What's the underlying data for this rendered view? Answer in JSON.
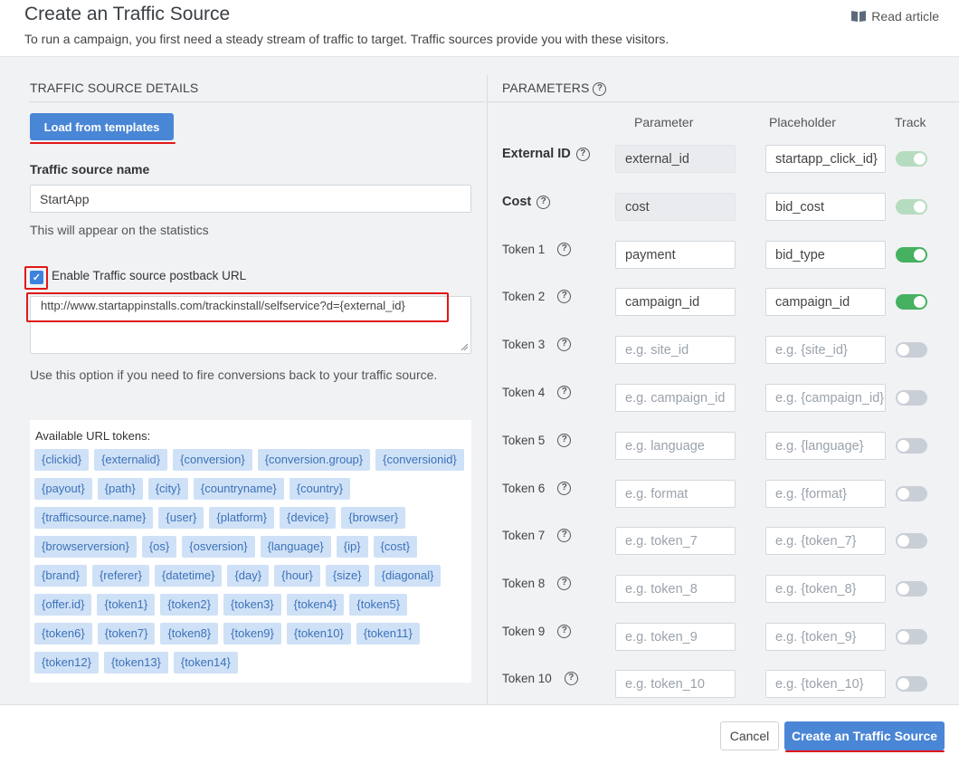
{
  "header": {
    "title": "Create an Traffic Source",
    "subtitle": "To run a campaign, you first need a steady stream of traffic to target. Traffic sources provide you with these visitors.",
    "read_article": "Read article"
  },
  "details": {
    "section_title": "TRAFFIC SOURCE DETAILS",
    "load_templates": "Load from templates",
    "name_label": "Traffic source name",
    "name_value": "StartApp",
    "name_help": "This will appear on the statistics",
    "postback_enabled": true,
    "postback_label": "Enable Traffic source postback URL",
    "postback_url": "http://www.startappinstalls.com/trackinstall/selfservice?d={external_id}",
    "postback_help": "Use this option if you need to fire conversions back to your traffic source.",
    "tokens_title": "Available URL tokens:",
    "tokens": [
      "{clickid}",
      "{externalid}",
      "{conversion}",
      "{conversion.group}",
      "{conversionid}",
      "{payout}",
      "{path}",
      "{city}",
      "{countryname}",
      "{country}",
      "{trafficsource.name}",
      "{user}",
      "{platform}",
      "{device}",
      "{browser}",
      "{browserversion}",
      "{os}",
      "{osversion}",
      "{language}",
      "{ip}",
      "{cost}",
      "{brand}",
      "{referer}",
      "{datetime}",
      "{day}",
      "{hour}",
      "{size}",
      "{diagonal}",
      "{offer.id}",
      "{token1}",
      "{token2}",
      "{token3}",
      "{token4}",
      "{token5}",
      "{token6}",
      "{token7}",
      "{token8}",
      "{token9}",
      "{token10}",
      "{token11}",
      "{token12}",
      "{token13}",
      "{token14}"
    ]
  },
  "parameters": {
    "section_title": "PARAMETERS",
    "col_parameter": "Parameter",
    "col_placeholder": "Placeholder",
    "col_track": "Track",
    "rows": [
      {
        "name": "External ID",
        "bold": true,
        "param": "external_id",
        "param_readonly": true,
        "placeholder": "startapp_click_id}",
        "placeholder_is_hint": false,
        "track": "dim"
      },
      {
        "name": "Cost",
        "bold": true,
        "param": "cost",
        "param_readonly": true,
        "placeholder": "bid_cost",
        "placeholder_is_hint": false,
        "track": "dim"
      },
      {
        "name": "Token 1",
        "bold": false,
        "param": "payment",
        "param_readonly": false,
        "placeholder": "bid_type",
        "placeholder_is_hint": false,
        "track": "on"
      },
      {
        "name": "Token 2",
        "bold": false,
        "param": "campaign_id",
        "param_readonly": false,
        "placeholder": "campaign_id",
        "placeholder_is_hint": false,
        "track": "on"
      },
      {
        "name": "Token 3",
        "bold": false,
        "param": "e.g. site_id",
        "param_hint": true,
        "placeholder": "e.g. {site_id}",
        "placeholder_is_hint": true,
        "track": "off"
      },
      {
        "name": "Token 4",
        "bold": false,
        "param": "e.g. campaign_id",
        "param_hint": true,
        "placeholder": "e.g. {campaign_id}",
        "placeholder_is_hint": true,
        "track": "off"
      },
      {
        "name": "Token 5",
        "bold": false,
        "param": "e.g. language",
        "param_hint": true,
        "placeholder": "e.g. {language}",
        "placeholder_is_hint": true,
        "track": "off"
      },
      {
        "name": "Token 6",
        "bold": false,
        "param": "e.g. format",
        "param_hint": true,
        "placeholder": "e.g. {format}",
        "placeholder_is_hint": true,
        "track": "off"
      },
      {
        "name": "Token 7",
        "bold": false,
        "param": "e.g. token_7",
        "param_hint": true,
        "placeholder": "e.g. {token_7}",
        "placeholder_is_hint": true,
        "track": "off"
      },
      {
        "name": "Token 8",
        "bold": false,
        "param": "e.g. token_8",
        "param_hint": true,
        "placeholder": "e.g. {token_8}",
        "placeholder_is_hint": true,
        "track": "off"
      },
      {
        "name": "Token 9",
        "bold": false,
        "param": "e.g. token_9",
        "param_hint": true,
        "placeholder": "e.g. {token_9}",
        "placeholder_is_hint": true,
        "track": "off"
      },
      {
        "name": "Token 10",
        "bold": false,
        "param": "e.g. token_10",
        "param_hint": true,
        "placeholder": "e.g. {token_10}",
        "placeholder_is_hint": true,
        "track": "off"
      }
    ]
  },
  "footer": {
    "cancel": "Cancel",
    "create": "Create an Traffic Source"
  },
  "colors": {
    "primary": "#4a86d6",
    "toggle_on": "#45b161",
    "highlight": "#e01818",
    "token_chip_bg": "#cfe1f7",
    "token_chip_text": "#3c72b8"
  }
}
